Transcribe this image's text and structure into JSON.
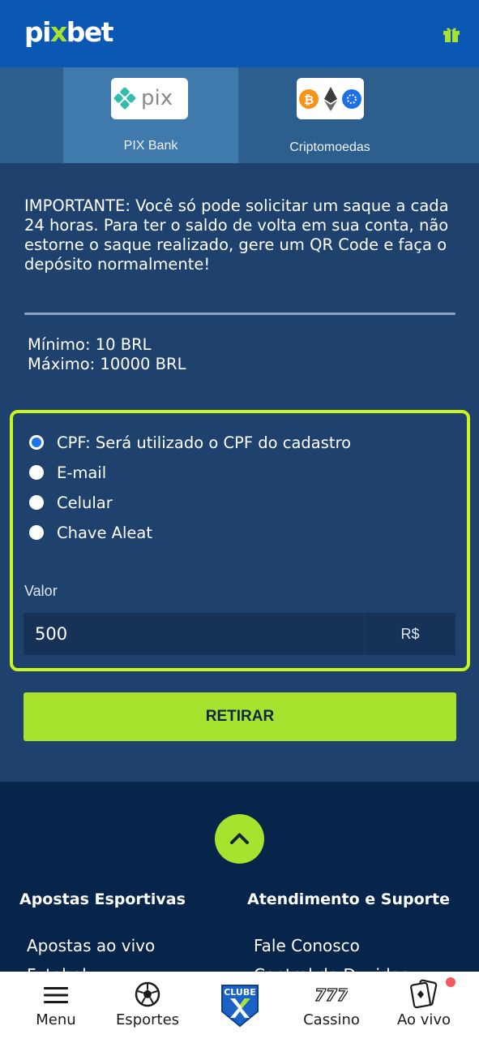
{
  "header": {
    "brand_pre": "pi",
    "brand_x": "x",
    "brand_post": "bet"
  },
  "tabs": [
    {
      "label": "PIX Bank",
      "logo_text": "pix",
      "active": true
    },
    {
      "label": "Criptomoedas",
      "logo_text": "₿",
      "active": false
    }
  ],
  "notice": "IMPORTANTE: Você só pode solicitar um saque a cada 24 horas. Para ter o saldo de volta em sua conta, não estorne o saque realizado, gere um QR Code e faça o depósito normalmente!",
  "limits": {
    "min": "Mínimo: 10 BRL",
    "max": "Máximo: 10000 BRL"
  },
  "form": {
    "options": [
      {
        "label": "CPF: Será utilizado o CPF do cadastro",
        "checked": true
      },
      {
        "label": "E-mail",
        "checked": false
      },
      {
        "label": "Celular",
        "checked": false
      },
      {
        "label": "Chave Aleat",
        "checked": false
      }
    ],
    "valor_label": "Valor",
    "valor_value": "500",
    "currency": "R$"
  },
  "submit_label": "RETIRAR",
  "footer": {
    "col1_title": "Apostas Esportivas",
    "col1_links": [
      "Apostas ao vivo",
      "Futebol"
    ],
    "col2_title": "Atendimento e Suporte",
    "col2_links": [
      "Fale Conosco",
      "Central de Duvidas"
    ]
  },
  "bottom_nav": {
    "menu": "Menu",
    "esportes": "Esportes",
    "clube": "CLUBE",
    "cassino": "Cassino",
    "ao_vivo": "Ao vivo"
  },
  "colors": {
    "accent": "#a6e22e",
    "header": "#0b57b4",
    "page": "#1e426d",
    "footer": "#07244a",
    "highlight_border": "#ccf51d"
  }
}
